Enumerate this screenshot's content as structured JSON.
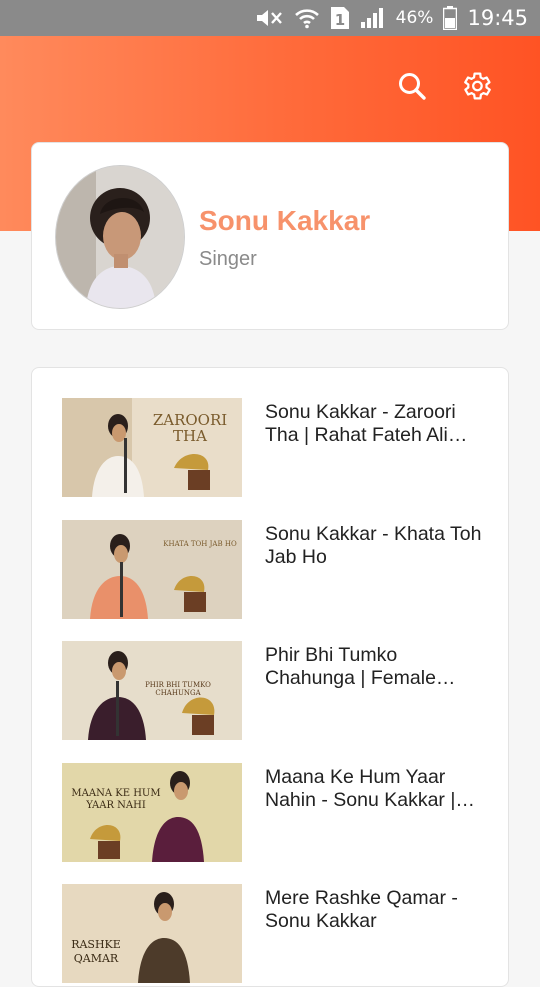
{
  "status_bar": {
    "battery_percent": "46%",
    "time": "19:45",
    "sim_label": "1",
    "icons": [
      "mute-icon",
      "wifi-icon",
      "sim-icon",
      "signal-icon",
      "battery-icon"
    ]
  },
  "header": {
    "icons": [
      "search-icon",
      "gear-icon"
    ],
    "accent_color": "#ff5a2a"
  },
  "profile": {
    "name": "Sonu Kakkar",
    "role": "Singer",
    "name_color": "#f7926b"
  },
  "videos": [
    {
      "title": "Sonu Kakkar - Zaroori Tha | Rahat Fateh Ali Khan",
      "thumb_text_1": "ZAROORI",
      "thumb_text_2": "THA"
    },
    {
      "title": "Sonu Kakkar - Khata Toh Jab Ho",
      "thumb_text_1": "KHATA TOH JAB HO",
      "thumb_text_2": ""
    },
    {
      "title": "Phir Bhi Tumko Chahunga | Female Version",
      "thumb_text_1": "PHIR BHI TUMKO",
      "thumb_text_2": "CHAHUNGA"
    },
    {
      "title": "Maana Ke Hum Yaar Nahin - Sonu Kakkar | Cover",
      "thumb_text_1": "MAANA KE HUM",
      "thumb_text_2": "YAAR NAHI"
    },
    {
      "title": "Mere Rashke Qamar - Sonu Kakkar",
      "thumb_text_1": "RASHKE",
      "thumb_text_2": "QAMAR"
    }
  ]
}
